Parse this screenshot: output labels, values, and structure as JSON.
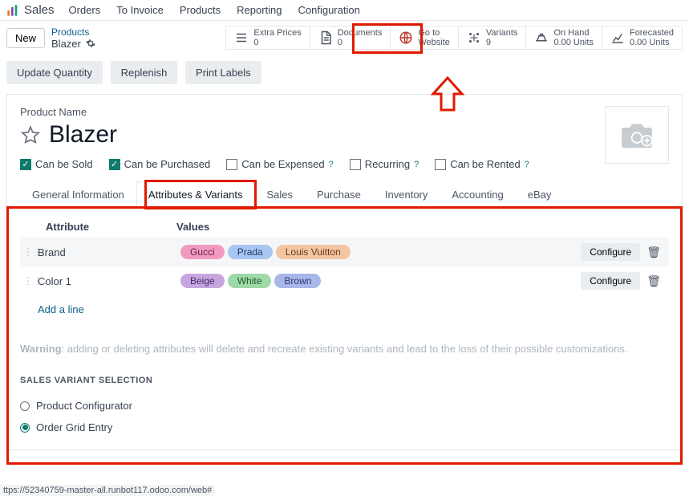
{
  "nav": {
    "app": "Sales",
    "items": [
      "Orders",
      "To Invoice",
      "Products",
      "Reporting",
      "Configuration"
    ]
  },
  "new_btn": "New",
  "breadcrumb": {
    "parent": "Products",
    "name": "Blazer"
  },
  "stats": [
    {
      "icon": "list",
      "label": "Extra Prices",
      "val": "0"
    },
    {
      "icon": "doc",
      "label": "Documents",
      "val": "0"
    },
    {
      "icon": "globe",
      "label": "Go to",
      "val": "Website"
    },
    {
      "icon": "variants",
      "label": "Variants",
      "val": "9"
    },
    {
      "icon": "onhand",
      "label": "On Hand",
      "val": "0.00 Units"
    },
    {
      "icon": "forecast",
      "label": "Forecasted",
      "val": "0.00 Units"
    }
  ],
  "actions": [
    "Update Quantity",
    "Replenish",
    "Print Labels"
  ],
  "product": {
    "name_label": "Product Name",
    "name": "Blazer"
  },
  "chks": [
    {
      "label": "Can be Sold",
      "on": true,
      "help": false
    },
    {
      "label": "Can be Purchased",
      "on": true,
      "help": false
    },
    {
      "label": "Can be Expensed",
      "on": false,
      "help": true
    },
    {
      "label": "Recurring",
      "on": false,
      "help": true
    },
    {
      "label": "Can be Rented",
      "on": false,
      "help": true
    }
  ],
  "tabs": [
    "General Information",
    "Attributes & Variants",
    "Sales",
    "Purchase",
    "Inventory",
    "Accounting",
    "eBay"
  ],
  "active_tab": 1,
  "attr_cols": {
    "a": "Attribute",
    "v": "Values"
  },
  "attrs": [
    {
      "name": "Brand",
      "tags": [
        {
          "t": "Gucci",
          "bg": "#f29bc1",
          "fg": "#6b2147"
        },
        {
          "t": "Prada",
          "bg": "#a8c6f0",
          "fg": "#1e3a6e"
        },
        {
          "t": "Louis Vuitton",
          "bg": "#f3c6a3",
          "fg": "#6b3a14"
        }
      ]
    },
    {
      "name": "Color 1",
      "tags": [
        {
          "t": "Beige",
          "bg": "#c7a6e0",
          "fg": "#4a2a66"
        },
        {
          "t": "White",
          "bg": "#9fd9a7",
          "fg": "#1f5d2b"
        },
        {
          "t": "Brown",
          "bg": "#a9b6e8",
          "fg": "#2b3a7a"
        }
      ]
    }
  ],
  "configure": "Configure",
  "add_line": "Add a line",
  "warning_lead": "Warning",
  "warning_rest": ": adding or deleting attributes will delete and recreate existing variants and lead to the loss of their possible customizations.",
  "variant_sel": {
    "head": "SALES VARIANT SELECTION",
    "opts": [
      "Product Configurator",
      "Order Grid Entry"
    ],
    "sel": 1
  },
  "status_url": "ttps://52340759-master-all.runbot117.odoo.com/web#"
}
